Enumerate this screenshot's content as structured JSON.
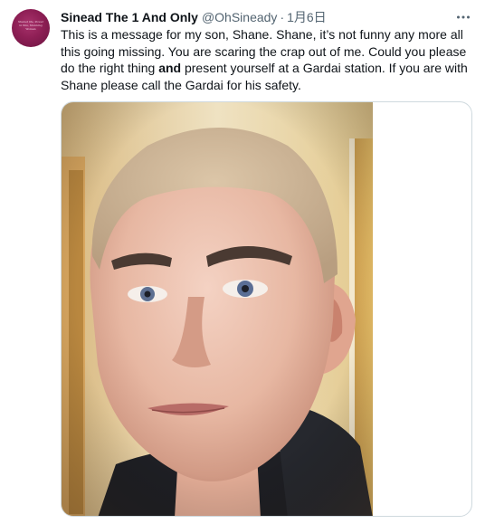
{
  "author": {
    "display_name": "Sinead The 1 And Only",
    "handle": "@OhSineady",
    "separator": "·",
    "date": "1月6日",
    "avatar_text": "Shared life, Power in this, Stunning Woman"
  },
  "tweet": {
    "text_before_bold": "This is a message for my son, Shane. Shane, it’s not funny any more all this going missing.  You are scaring the crap out of me.  Could you please do the right thing ",
    "bold_word": "and",
    "text_after_bold": " present yourself at a Gardai station. If you are with Shane please call the Gardai for his safety."
  },
  "icons": {
    "more": "more-horizontal-icon",
    "media": "photo-of-young-man"
  },
  "colors": {
    "text_primary": "#0f1419",
    "text_secondary": "#536471",
    "border": "#cfd9de",
    "avatar": "#8e1f55"
  }
}
